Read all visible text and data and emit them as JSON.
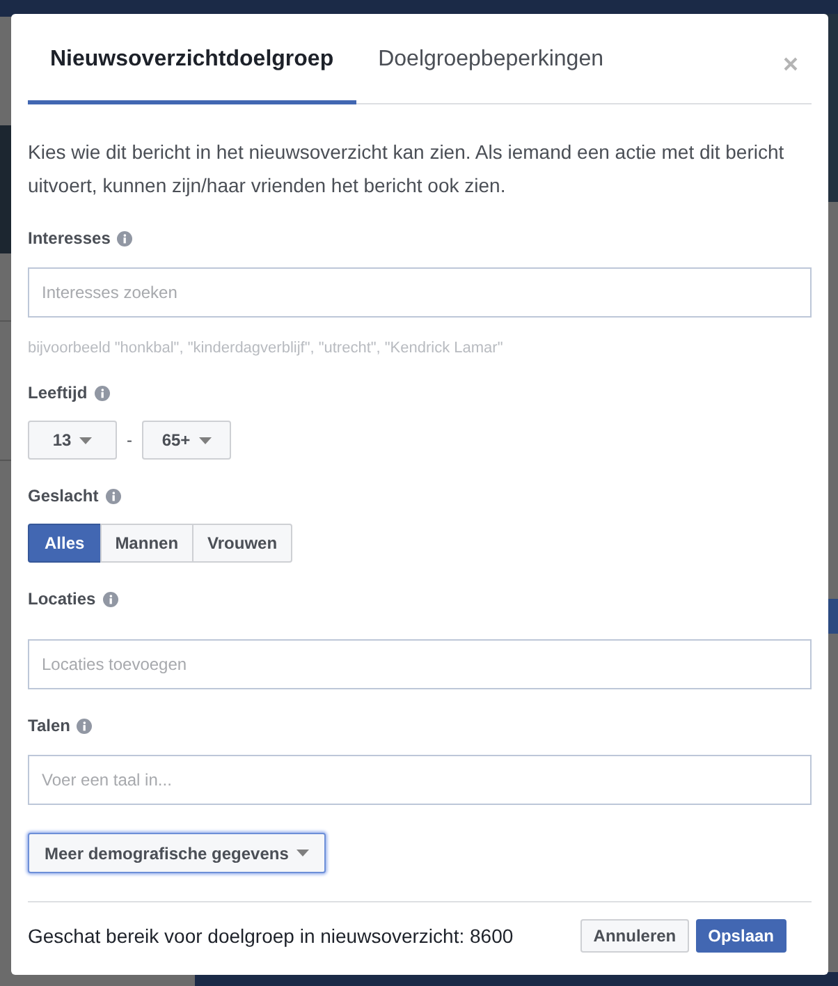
{
  "tabs": [
    {
      "label": "Nieuwsoverzichtdoelgroep",
      "selected": true
    },
    {
      "label": "Doelgroepbeperkingen",
      "selected": false
    }
  ],
  "description": "Kies wie dit bericht in het nieuwsoverzicht kan zien. Als iemand een actie met dit bericht uitvoert, kunnen zijn/haar vrienden het bericht ook zien.",
  "fields": [
    {
      "kind": "search",
      "label": "Interesses",
      "placeholder": "Interesses zoeken",
      "hint": "bijvoorbeeld \"honkbal\", \"kinderdagverblijf\", \"utrecht\", \"Kendrick Lamar\""
    },
    {
      "kind": "age",
      "label": "Leeftijd",
      "min": "13",
      "separator": "-",
      "max": "65+"
    },
    {
      "kind": "segmented",
      "label": "Geslacht",
      "options": [
        {
          "label": "Alles",
          "selected": true
        },
        {
          "label": "Mannen",
          "selected": false
        },
        {
          "label": "Vrouwen",
          "selected": false
        }
      ]
    },
    {
      "kind": "search",
      "label": "Locaties",
      "placeholder": "Locaties toevoegen"
    },
    {
      "kind": "search",
      "label": "Talen",
      "placeholder": "Voer een taal in..."
    }
  ],
  "more_button": {
    "label": "Meer demografische gegevens",
    "focused": true
  },
  "footer": {
    "reach": "Geschat bereik voor doelgroep in nieuwsoverzicht: 8600",
    "buttons": [
      {
        "label": "Annuleren",
        "kind": "secondary"
      },
      {
        "label": "Opslaan",
        "kind": "primary"
      }
    ]
  }
}
